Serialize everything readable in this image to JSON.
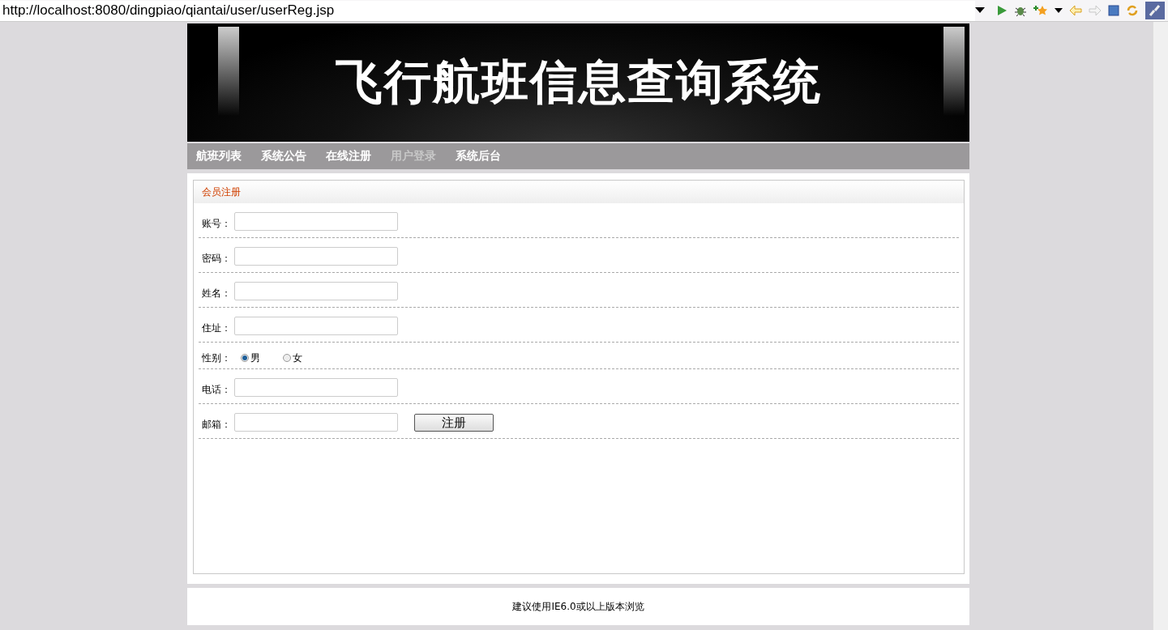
{
  "address_bar": {
    "url": "http://localhost:8080/dingpiao/qiantai/user/userReg.jsp"
  },
  "banner": {
    "title": "飞行航班信息查询系统"
  },
  "nav": [
    {
      "label": "航班列表",
      "hover": false
    },
    {
      "label": "系统公告",
      "hover": false
    },
    {
      "label": "在线注册",
      "hover": false
    },
    {
      "label": "用户登录",
      "hover": true
    },
    {
      "label": "系统后台",
      "hover": false
    }
  ],
  "panel": {
    "title": "会员注册"
  },
  "form": {
    "rows": [
      {
        "kind": "text",
        "label": "账号："
      },
      {
        "kind": "text",
        "label": "密码："
      },
      {
        "kind": "text",
        "label": "姓名："
      },
      {
        "kind": "text",
        "label": "住址："
      },
      {
        "kind": "radio",
        "label": "性别：",
        "options": [
          {
            "label": "男",
            "selected": true
          },
          {
            "label": "女",
            "selected": false
          }
        ]
      },
      {
        "kind": "text",
        "label": "电话："
      },
      {
        "kind": "text",
        "label": "邮箱："
      }
    ],
    "submit": "注册"
  },
  "footer": {
    "text": "建议使用IE6.0或以上版本浏览"
  }
}
